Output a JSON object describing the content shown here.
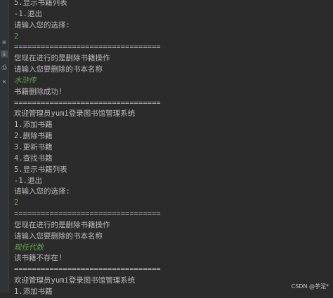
{
  "gutter": {
    "icons": [
      "soft-wrap-icon",
      "scroll-to-end-icon",
      "print-icon",
      "trash-icon"
    ]
  },
  "console": {
    "lines": [
      {
        "text": "5.显示书籍列表",
        "kind": "output"
      },
      {
        "text": "-1.退出",
        "kind": "output"
      },
      {
        "text": "请输入您的选择:",
        "kind": "output"
      },
      {
        "text": "2",
        "kind": "input"
      },
      {
        "text": "=================================",
        "kind": "output"
      },
      {
        "text": "您现在进行的是删除书籍操作",
        "kind": "output"
      },
      {
        "text": "请输入您要删除的书本名称",
        "kind": "output"
      },
      {
        "text": "水浒传",
        "kind": "input-italic"
      },
      {
        "text": "书籍删除成功!",
        "kind": "output"
      },
      {
        "text": "=================================",
        "kind": "output"
      },
      {
        "text": "欢迎管理员yumi登录图书馆管理系统",
        "kind": "output"
      },
      {
        "text": "1.添加书籍",
        "kind": "output"
      },
      {
        "text": "2.删除书籍",
        "kind": "output"
      },
      {
        "text": "3.更新书籍",
        "kind": "output"
      },
      {
        "text": "4.查找书籍",
        "kind": "output"
      },
      {
        "text": "5.显示书籍列表",
        "kind": "output"
      },
      {
        "text": "-1.退出",
        "kind": "output"
      },
      {
        "text": "请输入您的选择:",
        "kind": "output"
      },
      {
        "text": "2",
        "kind": "input"
      },
      {
        "text": "=================================",
        "kind": "output"
      },
      {
        "text": "您现在进行的是删除书籍操作",
        "kind": "output"
      },
      {
        "text": "请输入您要删除的书本名称",
        "kind": "output"
      },
      {
        "text": "现任代数",
        "kind": "input-italic"
      },
      {
        "text": "该书籍不存在!",
        "kind": "output"
      },
      {
        "text": "=================================",
        "kind": "output"
      },
      {
        "text": "欢迎管理员yumi登录图书馆管理系统",
        "kind": "output"
      },
      {
        "text": "1.添加书籍",
        "kind": "output"
      }
    ]
  },
  "watermark": {
    "text": "CSDN @芋泥*"
  },
  "colors": {
    "background": "#2b2b2b",
    "output_text": "#bbbbbb",
    "input_text": "#62a64b"
  }
}
